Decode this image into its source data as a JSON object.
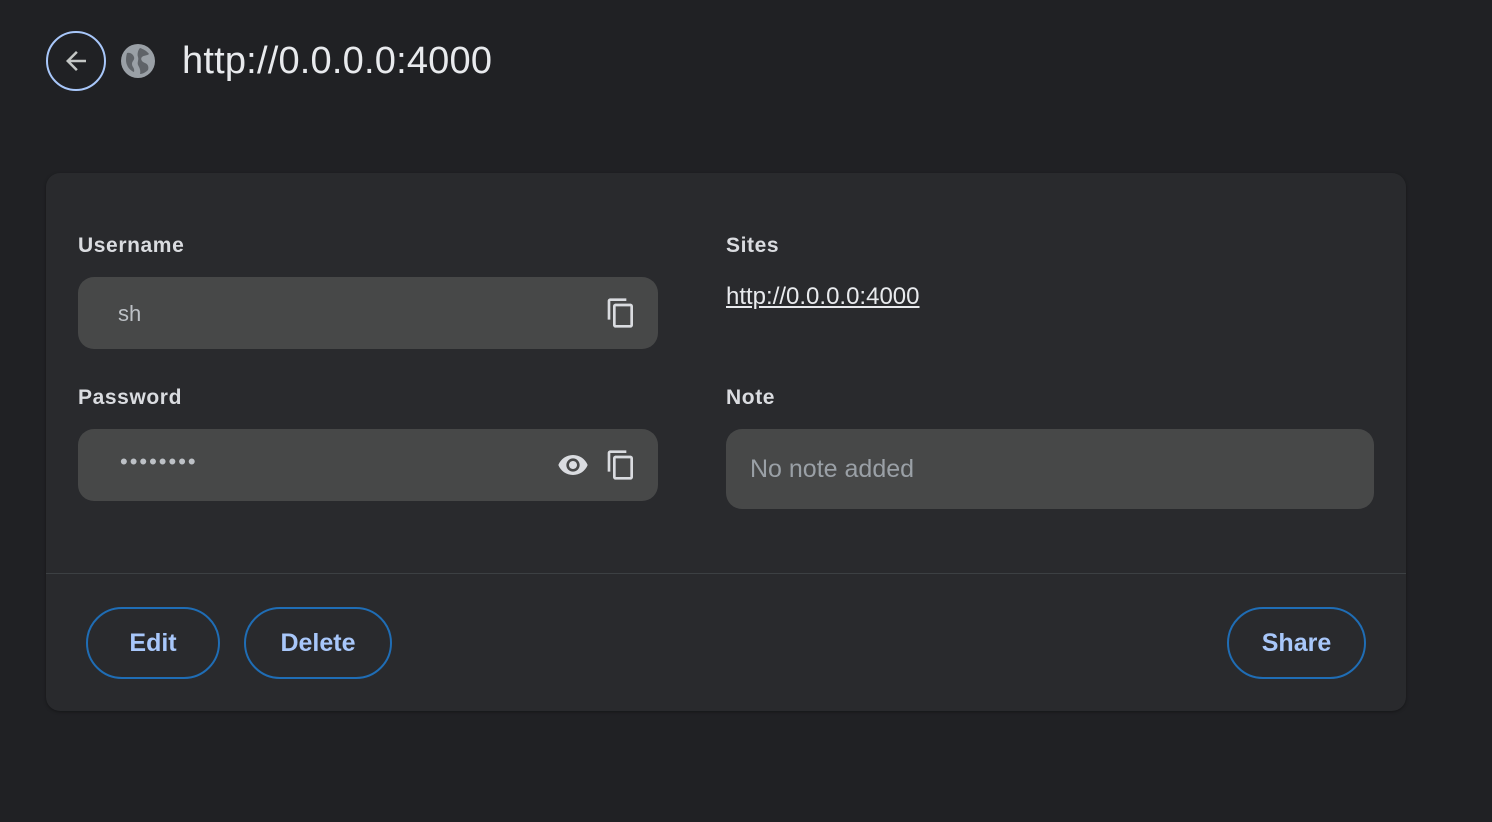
{
  "header": {
    "back_icon": "arrow-back-icon",
    "site_icon": "globe-icon",
    "title": "http://0.0.0.0:4000"
  },
  "credential": {
    "username_label": "Username",
    "username_value": "sh",
    "password_label": "Password",
    "password_value": "••••••••",
    "sites_label": "Sites",
    "site_url": "http://0.0.0.0:4000",
    "note_label": "Note",
    "note_placeholder": "No note added"
  },
  "actions": {
    "edit_label": "Edit",
    "delete_label": "Delete",
    "share_label": "Share"
  },
  "colors": {
    "background": "#202124",
    "card": "#292a2d",
    "field": "#474848",
    "accent": "#a8c7fa",
    "button_border": "#1f6db5"
  }
}
